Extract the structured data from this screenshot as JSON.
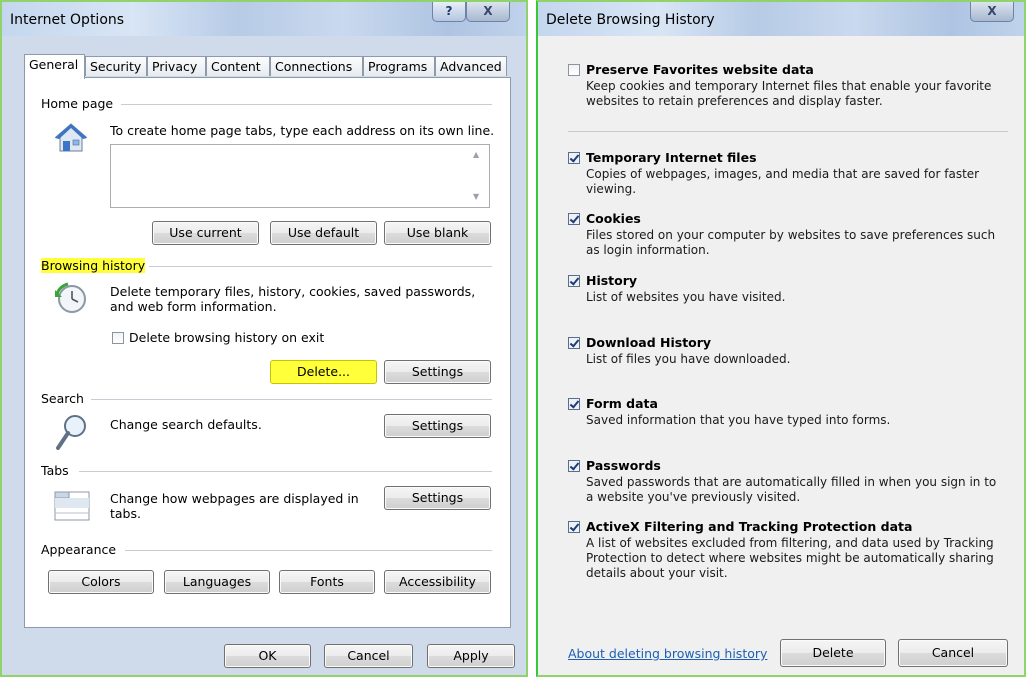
{
  "internet_options": {
    "title": "Internet Options",
    "help_btn": "?",
    "close_btn": "X",
    "tabs": [
      "General",
      "Security",
      "Privacy",
      "Content",
      "Connections",
      "Programs",
      "Advanced"
    ],
    "home_page": {
      "heading": "Home page",
      "description": "To create home page tabs, type each address on its own line.",
      "value": "",
      "buttons": [
        "Use current",
        "Use default",
        "Use blank"
      ]
    },
    "browsing_history": {
      "heading": "Browsing history",
      "description": "Delete temporary files, history, cookies, saved passwords, and web form information.",
      "checkbox_label": "Delete browsing history on exit",
      "delete_btn": "Delete...",
      "settings_btn": "Settings"
    },
    "search": {
      "heading": "Search",
      "description": "Change search defaults.",
      "settings_btn": "Settings"
    },
    "tabs_section": {
      "heading": "Tabs",
      "description": "Change how webpages are displayed in tabs.",
      "settings_btn": "Settings"
    },
    "appearance": {
      "heading": "Appearance",
      "buttons": [
        "Colors",
        "Languages",
        "Fonts",
        "Accessibility"
      ]
    },
    "footer": [
      "OK",
      "Cancel",
      "Apply"
    ]
  },
  "delete_history": {
    "title": "Delete Browsing History",
    "close_btn": "X",
    "items": [
      {
        "label": "Preserve Favorites website data",
        "desc": "Keep cookies and temporary Internet files that enable your favorite websites to retain preferences and display faster.",
        "checked": false
      },
      {
        "label": "Temporary Internet files",
        "desc": "Copies of webpages, images, and media that are saved for faster viewing.",
        "checked": true
      },
      {
        "label": "Cookies",
        "desc": "Files stored on your computer by websites to save preferences such as login information.",
        "checked": true
      },
      {
        "label": "History",
        "desc": "List of websites you have visited.",
        "checked": true
      },
      {
        "label": "Download History",
        "desc": "List of files you have downloaded.",
        "checked": true
      },
      {
        "label": "Form data",
        "desc": "Saved information that you have typed into forms.",
        "checked": true
      },
      {
        "label": "Passwords",
        "desc": "Saved passwords that are automatically filled in when you sign in to a website you've previously visited.",
        "checked": true
      },
      {
        "label": "ActiveX Filtering and Tracking Protection data",
        "desc": "A list of websites excluded from filtering, and data used by Tracking Protection to detect where websites might be automatically sharing details about your visit.",
        "checked": true
      }
    ],
    "about_link": "About deleting browsing history",
    "delete_btn": "Delete",
    "cancel_btn": "Cancel"
  }
}
